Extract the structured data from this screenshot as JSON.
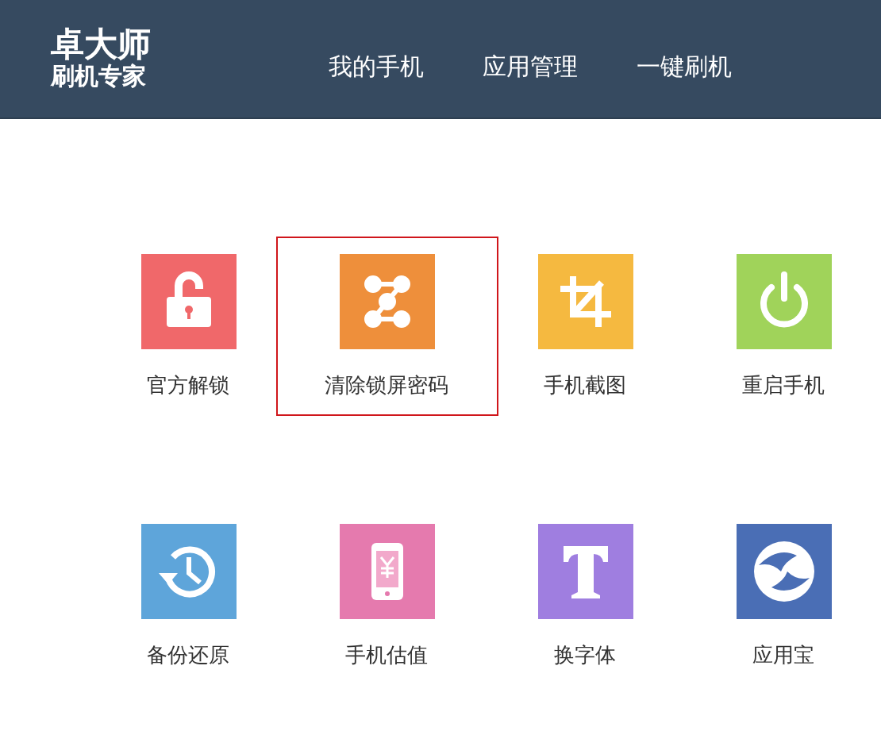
{
  "logo": {
    "title": "卓大师",
    "subtitle": "刷机专家"
  },
  "nav": [
    "我的手机",
    "应用管理",
    "一键刷机"
  ],
  "tools": [
    {
      "label": "官方解锁",
      "kind": "unlock",
      "color": "#f0686a",
      "selected": false
    },
    {
      "label": "清除锁屏密码",
      "kind": "pattern",
      "color": "#ee8f3b",
      "selected": true
    },
    {
      "label": "手机截图",
      "kind": "crop",
      "color": "#f5b940",
      "selected": false
    },
    {
      "label": "重启手机",
      "kind": "power",
      "color": "#a0d35a",
      "selected": false
    },
    {
      "label": "备份还原",
      "kind": "restore",
      "color": "#5ea5da",
      "selected": false
    },
    {
      "label": "手机估值",
      "kind": "phone",
      "color": "#e57aae",
      "selected": false
    },
    {
      "label": "换字体",
      "kind": "font",
      "color": "#9f7ee0",
      "selected": false
    },
    {
      "label": "应用宝",
      "kind": "store",
      "color": "#4a6eb5",
      "selected": false
    }
  ]
}
